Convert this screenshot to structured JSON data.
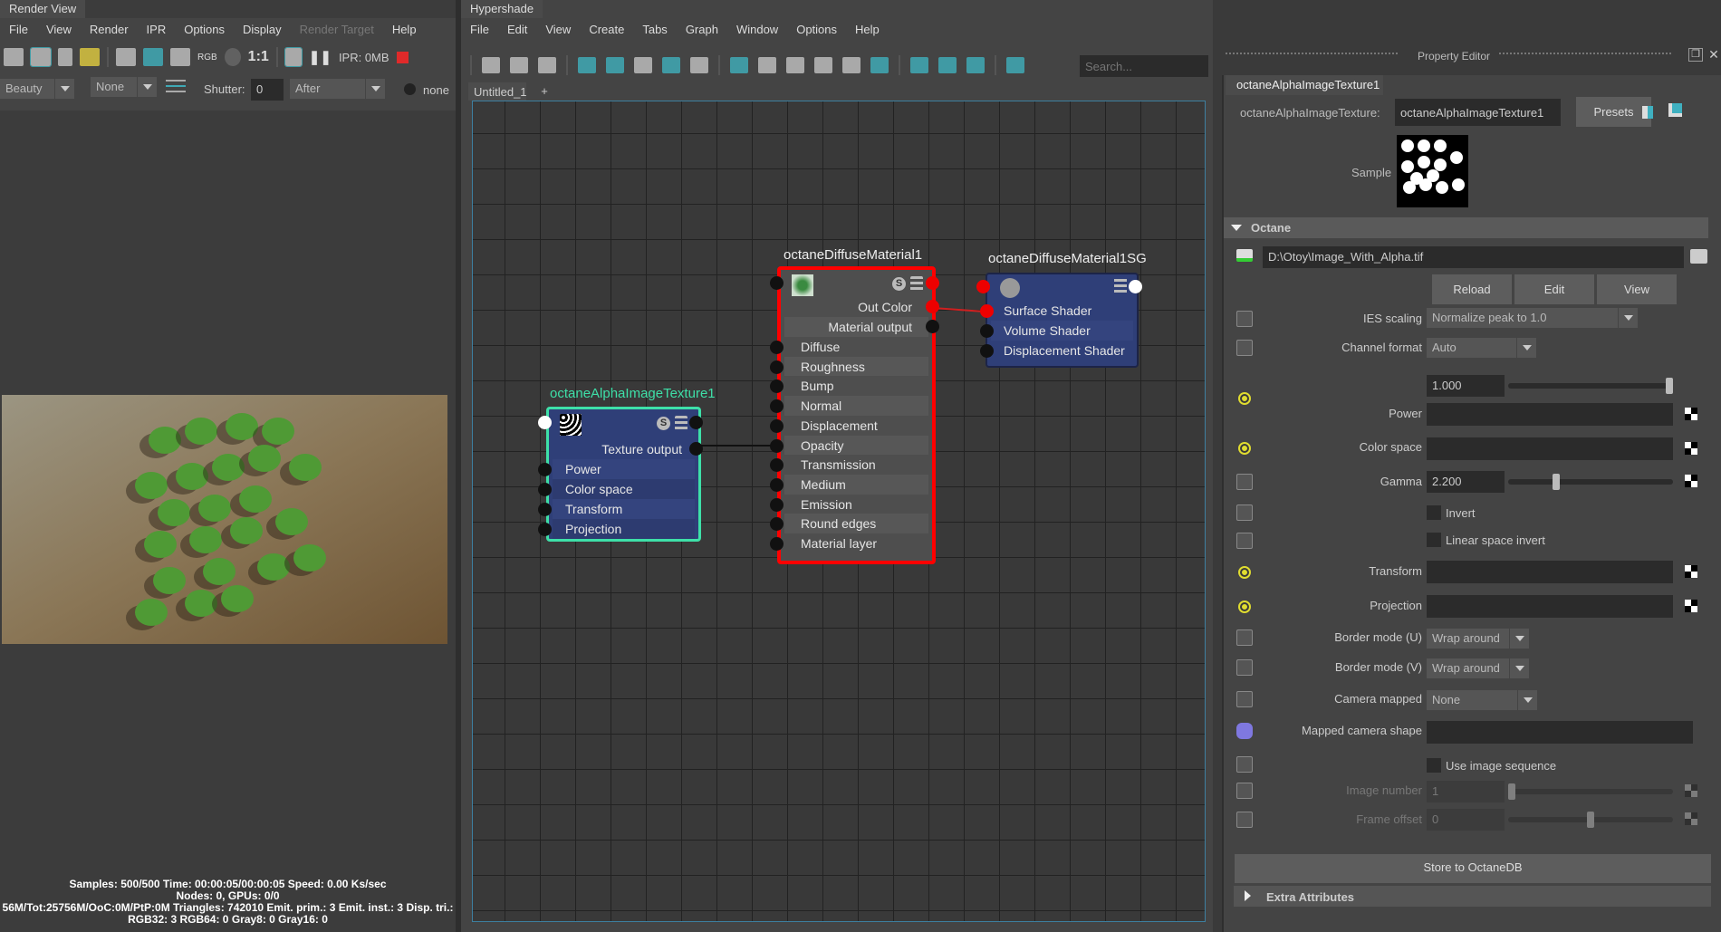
{
  "render_view": {
    "title": "Render View",
    "menu": [
      "File",
      "View",
      "Render",
      "IPR",
      "Options",
      "Display",
      "Render Target",
      "Help"
    ],
    "toolbar": {
      "rgb": "RGB",
      "ratio": "1:1",
      "ipr_mem": "IPR: 0MB"
    },
    "pass": "Beauty",
    "compare": "None",
    "shutter_label": "Shutter:",
    "shutter_value": "0",
    "after": "After",
    "none_label": "none",
    "status": [
      "Samples: 500/500 Time: 00:00:05/00:00:05 Speed: 0.00 Ks/sec",
      "Nodes: 0, GPUs: 0/0",
      "56M/Tot:25756M/OoC:0M/PtP:0M Triangles: 742010 Emit. prim.: 3 Emit. inst.: 3 Disp. tri.:",
      "RGB32: 3 RGB64: 0 Gray8: 0 Gray16: 0"
    ]
  },
  "hypershade": {
    "title": "Hypershade",
    "menu": [
      "File",
      "Edit",
      "View",
      "Create",
      "Tabs",
      "Graph",
      "Window",
      "Options",
      "Help"
    ],
    "toolbar_icons": [
      "input-connections-icon",
      "input-output-icon",
      "output-connections-icon",
      "frame-all-icon",
      "add-node-icon",
      "remove-node-icon",
      "graph-layout-icon",
      "pin-icon",
      "simple-view-icon",
      "connected-view-icon",
      "full-view-icon",
      "custom-view-icon",
      "search-zoom-icon",
      "render-swatch-icon",
      "grid-icon",
      "snap-grid-icon",
      "refresh-icon",
      "toggle-sidebar-icon"
    ],
    "search_placeholder": "Search...",
    "tabs": [
      {
        "label": "Untitled_1"
      }
    ],
    "add_tab": "+",
    "nodes": {
      "texture": {
        "title": "octaneAlphaImageTexture1",
        "output": "Texture output",
        "inputs": [
          "Power",
          "Color space",
          "Transform",
          "Projection"
        ]
      },
      "material": {
        "title": "octaneDiffuseMaterial1",
        "out_color": "Out Color",
        "output": "Material output",
        "inputs": [
          "Diffuse",
          "Roughness",
          "Bump",
          "Normal",
          "Displacement",
          "Opacity",
          "Transmission",
          "Medium",
          "Emission",
          "Round edges",
          "Material layer"
        ]
      },
      "sg": {
        "title": "octaneDiffuseMaterial1SG",
        "inputs": [
          "Surface Shader",
          "Volume Shader",
          "Displacement Shader"
        ]
      }
    },
    "colors": {
      "texture_border": "#3ee0a8",
      "material_border": "#ff0000",
      "node_body": "#2f3f78",
      "connection": "#d02020"
    }
  },
  "property_editor": {
    "title": "Property Editor",
    "tab": "octaneAlphaImageTexture1",
    "type_label": "octaneAlphaImageTexture:",
    "name_value": "octaneAlphaImageTexture1",
    "presets": "Presets",
    "sample_label": "Sample",
    "section": "Octane",
    "file_path": "D:\\Otoy\\Image_With_Alpha.tif",
    "buttons": [
      "Reload",
      "Edit",
      "View"
    ],
    "ies_scaling": {
      "label": "IES scaling",
      "value": "Normalize peak to 1.0"
    },
    "channel_format": {
      "label": "Channel format",
      "value": "Auto"
    },
    "power": {
      "label": "Power",
      "value": "1.000",
      "slider": 1.0
    },
    "color_space": {
      "label": "Color space"
    },
    "gamma": {
      "label": "Gamma",
      "value": "2.200",
      "slider": 0.28
    },
    "invert": {
      "label": "Invert",
      "checked": false
    },
    "linear_invert": {
      "label": "Linear space invert",
      "checked": false
    },
    "transform": {
      "label": "Transform"
    },
    "projection": {
      "label": "Projection"
    },
    "border_u": {
      "label": "Border mode (U)",
      "value": "Wrap around"
    },
    "border_v": {
      "label": "Border mode (V)",
      "value": "Wrap around"
    },
    "camera_mapped": {
      "label": "Camera mapped",
      "value": "None"
    },
    "mapped_camera_shape": {
      "label": "Mapped camera shape"
    },
    "use_sequence": {
      "label": "Use image sequence",
      "checked": false
    },
    "image_number": {
      "label": "Image number",
      "value": "1",
      "slider": 0.0
    },
    "frame_offset": {
      "label": "Frame offset",
      "value": "0",
      "slider": 0.5
    },
    "store": "Store to OctaneDB",
    "extra": "Extra Attributes"
  }
}
